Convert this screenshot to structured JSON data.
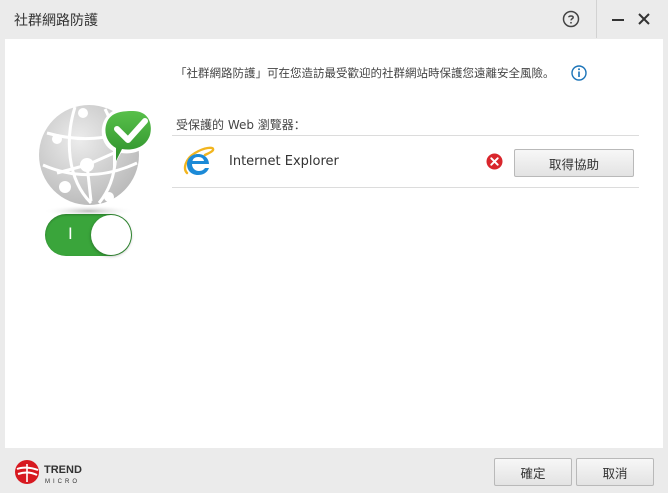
{
  "window": {
    "title": "社群網路防護"
  },
  "main": {
    "description": "「社群網路防護」可在您造訪最受歡迎的社群網站時保護您遠離安全風險。",
    "protected_browsers_label": "受保護的 Web 瀏覽器：",
    "browsers": [
      {
        "name": "Internet Explorer",
        "status": "error",
        "action_label": "取得協助"
      }
    ],
    "toggle": {
      "state": "on",
      "label": "I"
    }
  },
  "footer": {
    "ok_label": "確定",
    "cancel_label": "取消",
    "logo_text_top": "TREND",
    "logo_text_bottom": "MICRO"
  },
  "colors": {
    "accent_green": "#3aa53b",
    "error_red": "#d9262c",
    "info_blue": "#1a73b8",
    "logo_red": "#d71920"
  }
}
